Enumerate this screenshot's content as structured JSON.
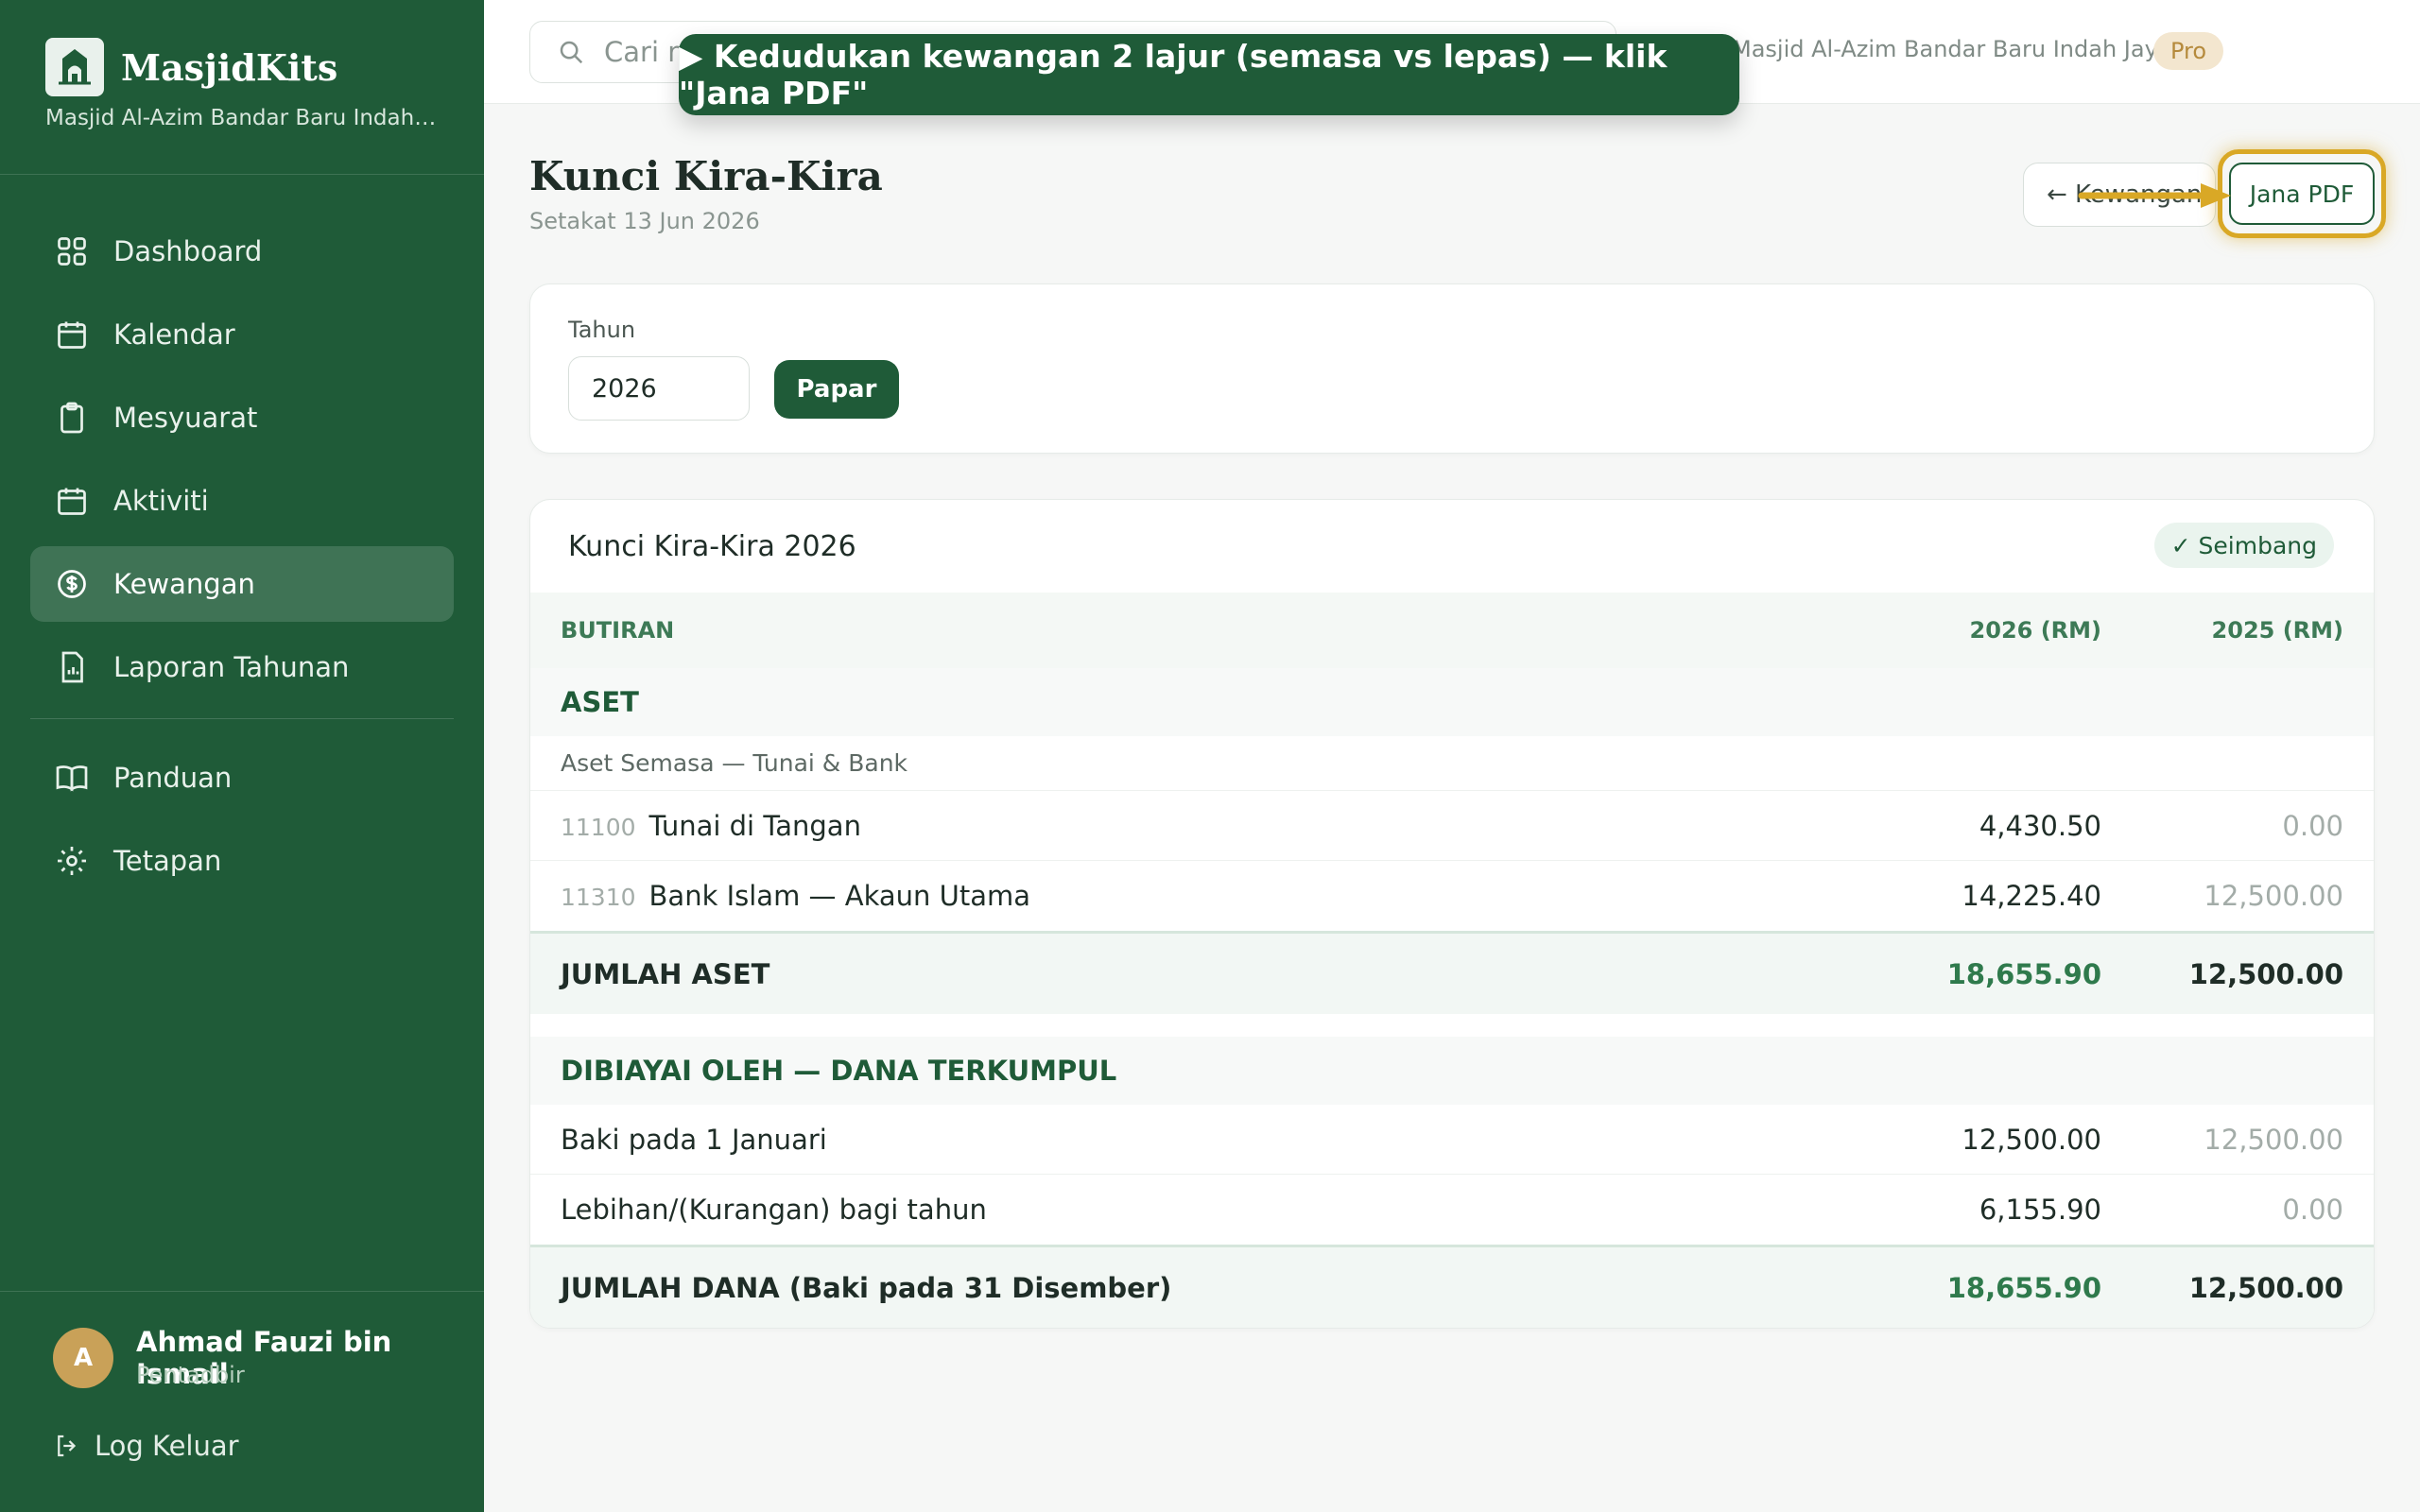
{
  "brand": {
    "name": "MasjidKits",
    "subtitle": "Masjid Al-Azim Bandar Baru Indah Jaya"
  },
  "nav": {
    "items": [
      {
        "label": "Dashboard",
        "icon": "grid-icon"
      },
      {
        "label": "Kalendar",
        "icon": "calendar-icon"
      },
      {
        "label": "Mesyuarat",
        "icon": "clipboard-icon"
      },
      {
        "label": "Aktiviti",
        "icon": "calendar-icon"
      },
      {
        "label": "Kewangan",
        "icon": "dollar-circle-icon",
        "active": true
      },
      {
        "label": "Laporan Tahunan",
        "icon": "report-icon"
      }
    ],
    "secondary": [
      {
        "label": "Panduan",
        "icon": "book-icon"
      },
      {
        "label": "Tetapan",
        "icon": "gear-icon"
      }
    ]
  },
  "user": {
    "initial": "A",
    "name": "Ahmad Fauzi bin Ismail",
    "role": "Pentadbir",
    "logout": "Log Keluar"
  },
  "topbar": {
    "search_placeholder": "Cari m",
    "org": "Masjid Al-Azim Bandar Baru Indah Jaya",
    "plan": "Pro"
  },
  "tour": {
    "text": "▶ Kedudukan kewangan 2 lajur (semasa vs lepas) — klik \"Jana PDF\""
  },
  "page": {
    "title": "Kunci Kira-Kira",
    "subtitle": "Setakat 13 Jun 2026",
    "back_label": "← Kewangan",
    "pdf_label": "Jana PDF"
  },
  "filter": {
    "label": "Tahun",
    "year": "2026",
    "apply": "Papar"
  },
  "report": {
    "title": "Kunci Kira-Kira 2026",
    "status": "✓ Seimbang",
    "columns": {
      "item": "BUTIRAN",
      "current": "2026 (RM)",
      "previous": "2025 (RM)"
    },
    "assets": {
      "heading": "ASET",
      "sub": "Aset Semasa — Tunai & Bank",
      "rows": [
        {
          "code": "11100",
          "label": "Tunai di Tangan",
          "current": "4,430.50",
          "previous": "0.00"
        },
        {
          "code": "11310",
          "label": "Bank Islam — Akaun Utama",
          "current": "14,225.40",
          "previous": "12,500.00"
        }
      ],
      "total_label": "JUMLAH ASET",
      "total_current": "18,655.90",
      "total_previous": "12,500.00"
    },
    "funds": {
      "heading": "DIBIAYAI OLEH — DANA TERKUMPUL",
      "rows": [
        {
          "label": "Baki pada 1 Januari",
          "current": "12,500.00",
          "previous": "12,500.00"
        },
        {
          "label": "Lebihan/(Kurangan) bagi tahun",
          "current": "6,155.90",
          "previous": "0.00"
        }
      ],
      "total_label": "JUMLAH DANA (Baki pada 31 Disember)",
      "total_current": "18,655.90",
      "total_previous": "12,500.00"
    }
  },
  "colors": {
    "primary": "#1f5b38",
    "accent": "#d9a826",
    "positive": "#2f7a4c"
  }
}
